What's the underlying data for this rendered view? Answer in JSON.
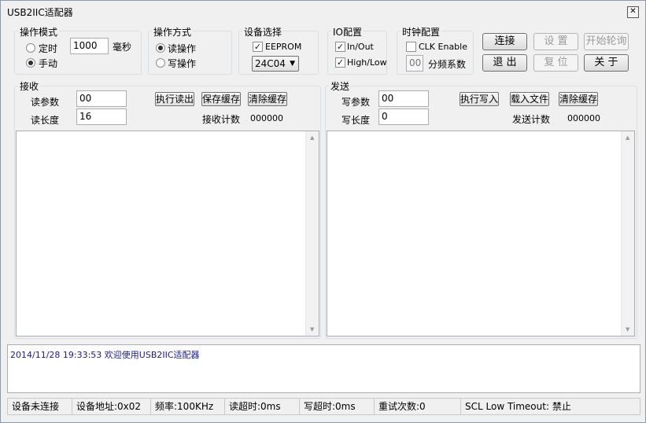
{
  "window": {
    "title": "USB2IIC适配器",
    "close_icon": "close-icon"
  },
  "op_mode": {
    "title": "操作模式",
    "timed_label": "定时",
    "manual_label": "手动",
    "interval_value": "1000",
    "unit": "毫秒",
    "timed_selected": false,
    "manual_selected": true
  },
  "op_method": {
    "title": "操作方式",
    "read_label": "读操作",
    "write_label": "写操作",
    "read_selected": true
  },
  "device": {
    "title": "设备选择",
    "eeprom_label": "EEPROM",
    "eeprom_checked": true,
    "chip_value": "24C04"
  },
  "io": {
    "title": "IO配置",
    "inout_label": "In/Out",
    "highlow_label": "High/Low",
    "inout_checked": true,
    "highlow_checked": true
  },
  "clock": {
    "title": "时钟配置",
    "clk_label": "CLK Enable",
    "clk_checked": false,
    "divider_value": "00",
    "divider_label": "分频系数"
  },
  "buttons": {
    "connect": "连接",
    "settings": "设 置",
    "start_poll": "开始轮询",
    "exit": "退 出",
    "reset": "复 位",
    "about": "关 于"
  },
  "receive": {
    "title": "接收",
    "param_label": "读参数",
    "param_value": "00",
    "length_label": "读长度",
    "length_value": "16",
    "exec_read": "执行读出",
    "save_cache": "保存缓存",
    "clear_cache": "清除缓存",
    "count_label": "接收计数",
    "count_value": "000000"
  },
  "send": {
    "title": "发送",
    "param_label": "写参数",
    "param_value": "00",
    "length_label": "写长度",
    "length_value": "0",
    "exec_write": "执行写入",
    "load_file": "载入文件",
    "clear_cache": "清除缓存",
    "count_label": "发送计数",
    "count_value": "000000"
  },
  "log": {
    "line": "2014/11/28 19:33:53  欢迎使用USB2IIC适配器"
  },
  "status": {
    "connection": "设备未连接",
    "address": "设备地址:0x02",
    "frequency": "频率:100KHz",
    "read_timeout": "读超时:0ms",
    "write_timeout": "写超时:0ms",
    "retries": "重试次数:0",
    "scl_timeout": "SCL Low Timeout: 禁止"
  }
}
